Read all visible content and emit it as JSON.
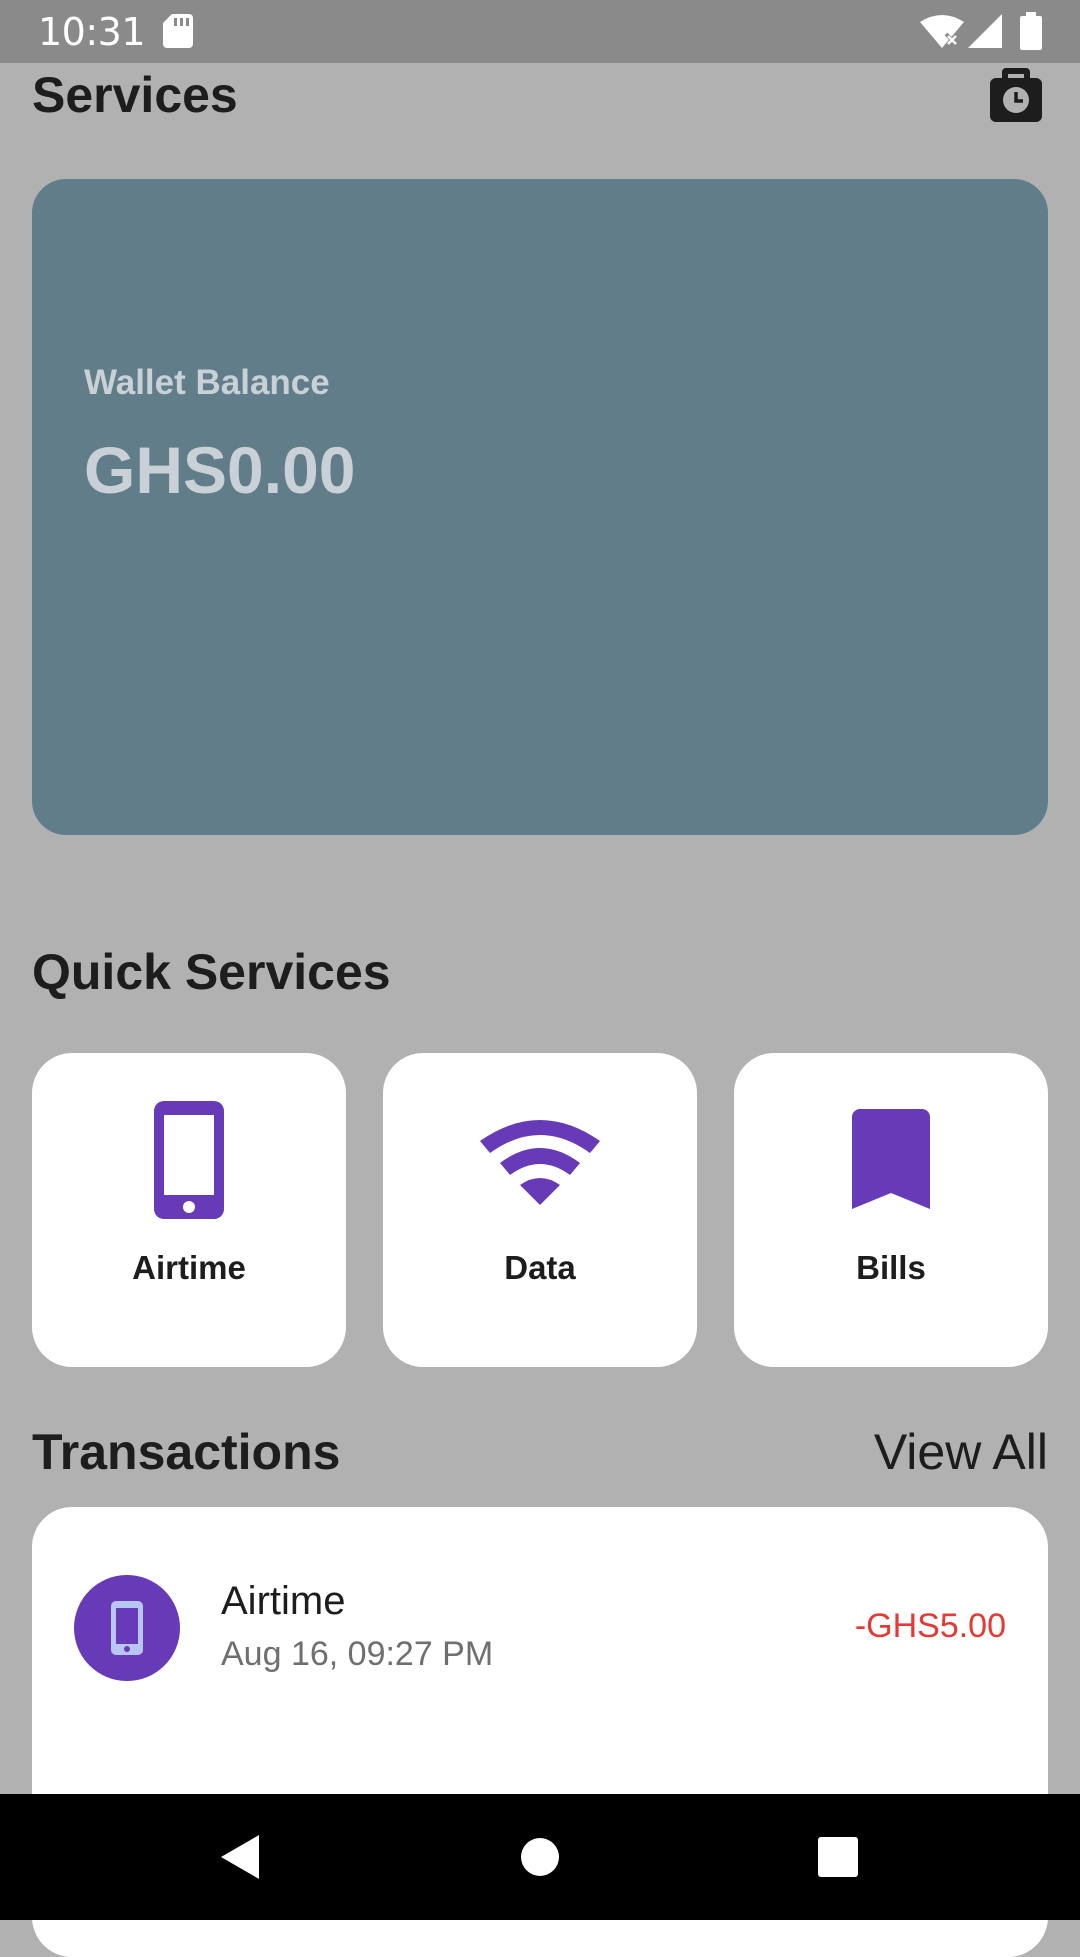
{
  "status_bar": {
    "time": "10:31",
    "icons": [
      "sd-card-icon",
      "wifi-off-icon",
      "cell-signal-icon",
      "battery-icon"
    ]
  },
  "header": {
    "title": "Services",
    "history_icon": "wallet-history-icon"
  },
  "wallet": {
    "label": "Wallet Balance",
    "amount": "GHS0.00",
    "card_color": "#617d8a"
  },
  "quick_services": {
    "title": "Quick Services",
    "items": [
      {
        "label": "Airtime",
        "icon": "phone-icon"
      },
      {
        "label": "Data",
        "icon": "wifi-icon"
      },
      {
        "label": "Bills",
        "icon": "bookmark-icon"
      }
    ],
    "icon_color": "#673ab7"
  },
  "transactions": {
    "title": "Transactions",
    "view_all": "View All",
    "items": [
      {
        "name": "Airtime",
        "date": "Aug 16, 09:27 PM",
        "amount": "-GHS5.00",
        "icon": "phone-icon"
      }
    ],
    "debit_color": "#e53935"
  },
  "nav_bar": {
    "buttons": [
      "back-icon",
      "home-icon",
      "recents-icon"
    ]
  }
}
